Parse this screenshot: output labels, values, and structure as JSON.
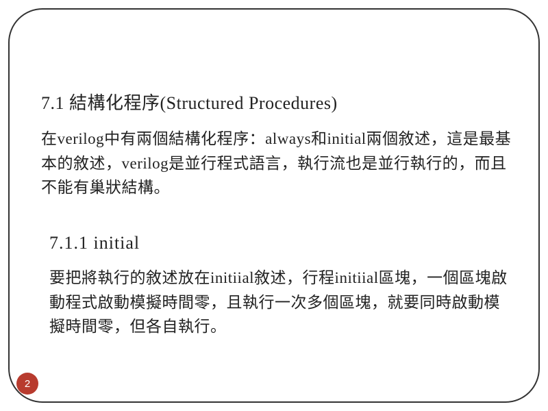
{
  "section1": {
    "heading": "7.1 結構化程序(Structured Procedures)",
    "body": "在verilog中有兩個結構化程序：always和initial兩個敘述，這是最基本的敘述，verilog是並行程式語言，執行流也是並行執行的，而且不能有巢狀結構。"
  },
  "section2": {
    "heading": "7.1.1 initial",
    "body": "要把將執行的敘述放在initiial敘述，行程initiial區塊，一個區塊啟動程式啟動模擬時間零，且執行一次多個區塊，就要同時啟動模擬時間零，但各自執行。"
  },
  "page_number": "2"
}
